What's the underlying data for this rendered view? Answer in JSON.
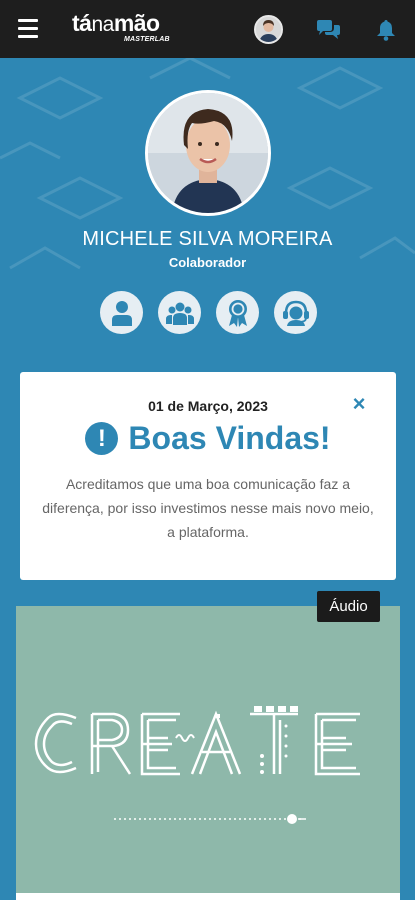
{
  "header": {
    "logo_main_1": "tá",
    "logo_main_2": "na",
    "logo_main_3": "mão",
    "logo_sub": "MASTERLAB",
    "icons": [
      "menu-icon",
      "avatar",
      "chat-icon",
      "bell-icon"
    ]
  },
  "profile": {
    "name": "MICHELE SILVA MOREIRA",
    "role": "Colaborador",
    "actions": [
      "user-icon",
      "group-icon",
      "award-icon",
      "support-icon"
    ]
  },
  "welcome": {
    "date": "01 de Março, 2023",
    "title": "Boas Vindas!",
    "icon": "exclamation-icon",
    "close": "×",
    "text": "Acreditamos que uma boa comunicação faz a diferença, por isso investimos nesse mais novo meio, a plataforma."
  },
  "media": {
    "tag": "Áudio",
    "artwork_word": "CREATE"
  },
  "colors": {
    "primary": "#2e87b4",
    "topbar": "#1e1e1e",
    "media_bg": "#8eb8aa"
  }
}
